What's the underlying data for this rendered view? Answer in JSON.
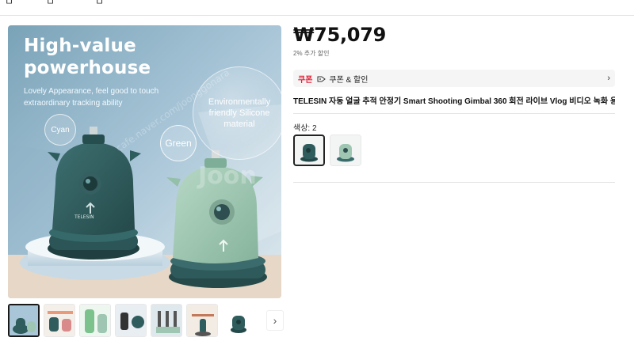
{
  "top_nav": {
    "item_a": "ㅁ",
    "item_b": "ㅁ",
    "item_c": "ㅁ"
  },
  "hero": {
    "title": "High-value\npowerhouse",
    "subtitle": "Lovely Appearance, feel good to touch\nextraordinary tracking ability",
    "feature_bubble": "Environmentally\nfriendly Silicone\nmaterial",
    "color_bubble_cyan": "Cyan",
    "color_bubble_green": "Green",
    "brand_on_device": "TELESIN",
    "watermark": "cafe.naver.com/joonggonara"
  },
  "thumbnails": {
    "count": 8,
    "active_index": 0,
    "next_icon": "chevron-right-icon"
  },
  "product": {
    "price": "₩75,079",
    "discount_note": "2% 추가 할인",
    "coupon_tag": "쿠폰",
    "coupon_text": "쿠폰 & 할인",
    "title": "TELESIN 자동 얼굴 추적 안정기 Smart Shooting Gimbal 360 회전 라이브 Vlog 비디오 녹화 용",
    "color_label": "색상: 2",
    "selected_color": 0
  },
  "colors": {
    "accent": "#e0233b",
    "device_dark": "#2f5d5e",
    "device_light": "#9fc6b2",
    "stage": "#d9e6ee"
  }
}
